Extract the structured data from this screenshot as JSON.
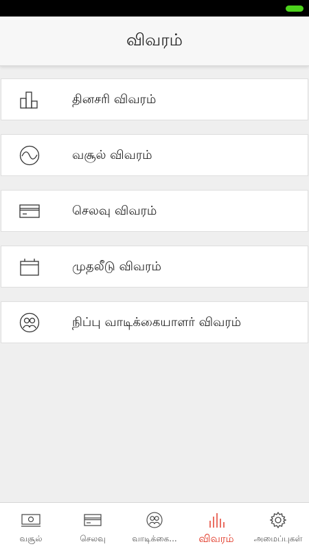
{
  "header": {
    "title": "விவரம்"
  },
  "list": [
    {
      "label": "தினசரி விவரம்",
      "icon": "bar-chart-icon"
    },
    {
      "label": "வசூல் விவரம்",
      "icon": "wave-circle-icon"
    },
    {
      "label": "செலவு விவரம்",
      "icon": "card-icon"
    },
    {
      "label": "முதலீடு விவரம்",
      "icon": "briefcase-icon"
    },
    {
      "label": "நிப்பு வாடிக்கையாளர் விவரம்",
      "icon": "customers-icon"
    }
  ],
  "tabs": [
    {
      "label": "வசூல்",
      "icon": "cash-icon"
    },
    {
      "label": "செலவு",
      "icon": "card-icon"
    },
    {
      "label": "வாடிக்கை...",
      "icon": "customers-icon"
    },
    {
      "label": "விவரம்",
      "icon": "report-icon",
      "active": true
    },
    {
      "label": "அமைப்புகள்",
      "icon": "gear-icon"
    }
  ],
  "colors": {
    "accent": "#e0301e",
    "battery": "#4cd21c"
  }
}
